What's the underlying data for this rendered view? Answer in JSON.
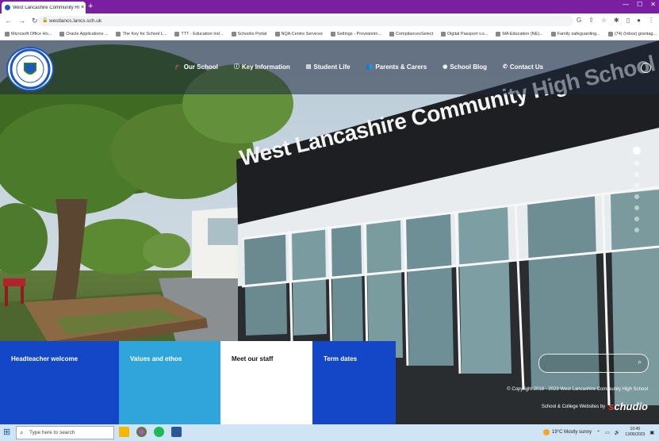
{
  "browser": {
    "tab_title": "West Lancashire Community Hig",
    "tab_close": "×",
    "new_tab": "+",
    "nav_back": "←",
    "nav_forward": "→",
    "nav_reload": "↻",
    "url": "westlancs.lancs.sch.uk",
    "bookmarks": [
      "Microsoft Office Ho...",
      "Oracle Applications ...",
      "The Key for School L...",
      "TTT - Education Ind...",
      "Schoolio Portal",
      "NQA Centre Services",
      "Settings - Provisionin...",
      "CompliancesSelect",
      "Digital Passport v.s...",
      "MA Education (NE)...",
      "Family safeguarding...",
      "(74) (Inbox) grantag..."
    ]
  },
  "header": {
    "nav": [
      {
        "icon": "graduation-cap-icon",
        "label": "Our School"
      },
      {
        "icon": "info-icon",
        "label": "Key Information"
      },
      {
        "icon": "book-icon",
        "label": "Student Life"
      },
      {
        "icon": "users-icon",
        "label": "Parents & Carers"
      },
      {
        "icon": "rss-icon",
        "label": "School Blog"
      },
      {
        "icon": "phone-icon",
        "label": "Contact Us"
      }
    ]
  },
  "hero": {
    "building_sign": "West Lancashire Community High School"
  },
  "tiles": [
    {
      "label": "Headteacher welcome"
    },
    {
      "label": "Values and ethos"
    },
    {
      "label": "Meet our staff"
    },
    {
      "label": "Term dates"
    }
  ],
  "footer": {
    "copyright": "© Copyright 2018 - 2023 West Lancashire Community High School",
    "credit": "School & College Websites by",
    "brand_s": "s",
    "brand_rest": "chudio"
  },
  "taskbar": {
    "search_placeholder": "Type here to search",
    "weather": "19°C  Mostly sunny",
    "time": "10:49",
    "date": "12/06/2023"
  },
  "colors": {
    "tab_bar": "#7b1fa2",
    "tile_blue": "#1447c8",
    "tile_light_blue": "#2fa5dc",
    "brand_red": "#e63b2e"
  }
}
